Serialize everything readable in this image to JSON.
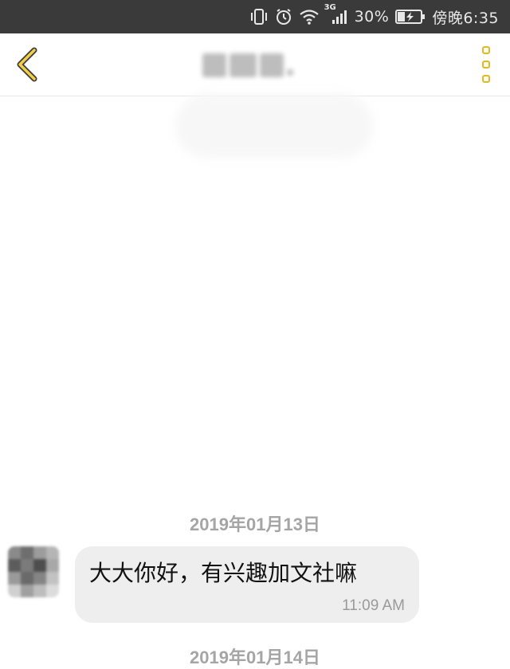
{
  "status_bar": {
    "network": "3G",
    "battery": "30%",
    "time": "傍晚6:35",
    "icons": [
      "vibrate-icon",
      "alarm-icon",
      "wifi-icon",
      "signal-icon",
      "battery-charging-icon"
    ]
  },
  "header": {
    "back_icon": "chevron-left-icon",
    "title": "",
    "menu_icon": "more-vertical-icon",
    "accent_color": "#e0b92b"
  },
  "messages": [
    {
      "date": "2019年01月13日",
      "text": "大大你好，有兴趣加文社嘛",
      "time": "11:09 AM"
    }
  ],
  "next_date": "2019年01月14日"
}
